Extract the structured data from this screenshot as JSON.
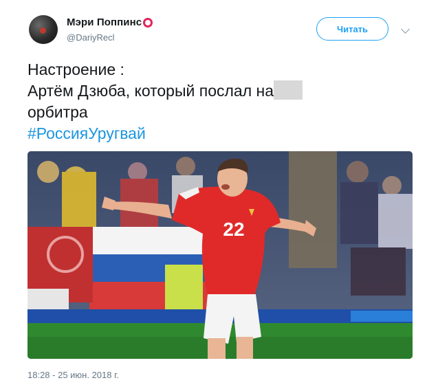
{
  "tweet": {
    "author_name": "Мэри Поппинс",
    "handle": "@DariyRecl",
    "follow_label": "Читать",
    "line1": "Настроение :",
    "line2": "Артём Дзюба, который послал на",
    "line3": "орбитра",
    "hashtag": "#РоссияУругвай",
    "timestamp": "18:28 - 25 июн. 2018 г."
  },
  "photo": {
    "jersey_number": "22",
    "jersey_color": "#e02a2a",
    "pitch_color": "#2f8a2f"
  },
  "colors": {
    "accent": "#1da1f2",
    "hashtag": "#1b95e0",
    "ring": "#e0245e",
    "secondary_text": "#657786"
  }
}
